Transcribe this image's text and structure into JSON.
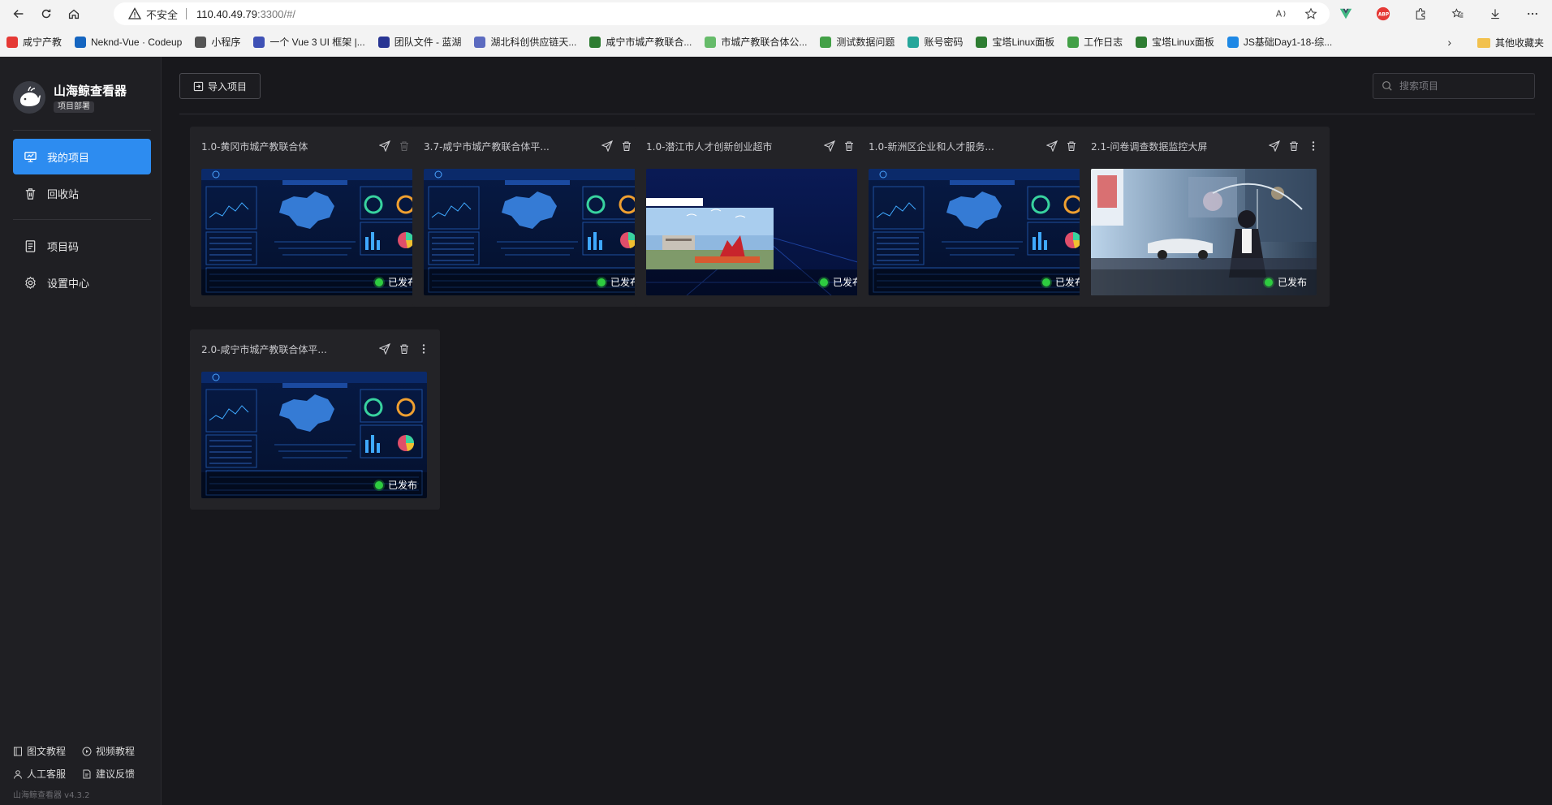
{
  "browser": {
    "security_label": "不安全",
    "url_host": "110.40.49.79",
    "url_path": ":3300/#/",
    "bookmarks": [
      {
        "label": "咸宁产教",
        "color": "#e53935"
      },
      {
        "label": "Neknd-Vue · Codeup",
        "color": "#1565c0"
      },
      {
        "label": "小程序",
        "color": "#555555"
      },
      {
        "label": "一个 Vue 3 UI 框架 |...",
        "color": "#3f51b5"
      },
      {
        "label": "团队文件 - 蓝湖",
        "color": "#283593"
      },
      {
        "label": "湖北科创供应链天...",
        "color": "#5c6bc0"
      },
      {
        "label": "咸宁市城产教联合...",
        "color": "#2e7d32"
      },
      {
        "label": "市城产教联合体公...",
        "color": "#66bb6a"
      },
      {
        "label": "测试数据问题",
        "color": "#43a047"
      },
      {
        "label": "账号密码",
        "color": "#26a69a"
      },
      {
        "label": "宝塔Linux面板",
        "color": "#2e7d32"
      },
      {
        "label": "工作日志",
        "color": "#43a047"
      },
      {
        "label": "宝塔Linux面板",
        "color": "#2e7d32"
      },
      {
        "label": "JS基础Day1-18-综...",
        "color": "#1e88e5"
      }
    ],
    "other_bookmarks": "其他收藏夹"
  },
  "sidebar": {
    "app_title": "山海鲸查看器",
    "badge": "项目部署",
    "menu": [
      {
        "label": "我的项目",
        "icon": "monitor-icon"
      },
      {
        "label": "回收站",
        "icon": "trash-icon"
      },
      {
        "label": "项目码",
        "icon": "document-icon"
      },
      {
        "label": "设置中心",
        "icon": "gear-icon"
      }
    ],
    "footer": {
      "doc_tutorial": "图文教程",
      "video_tutorial": "视频教程",
      "support": "人工客服",
      "feedback": "建议反馈",
      "version": "山海鲸查看器 v4.3.2"
    }
  },
  "toolbar": {
    "import_label": "导入项目",
    "search_placeholder": "搜索项目"
  },
  "projects": [
    {
      "title": "1.0-黄冈市城产教联合体",
      "status": "已发布",
      "thumb": "dashboard"
    },
    {
      "title": "3.7-咸宁市城产教联合体平...",
      "status": "已发布",
      "thumb": "dashboard"
    },
    {
      "title": "1.0-潜江市人才创新创业超市",
      "status": "已发布",
      "thumb": "photo"
    },
    {
      "title": "1.0-新洲区企业和人才服务...",
      "status": "已发布",
      "thumb": "dashboard"
    },
    {
      "title": "2.1-问卷调查数据监控大屏",
      "status": "已发布",
      "thumb": "anime"
    },
    {
      "title": "2.0-咸宁市城产教联合体平...",
      "status": "已发布",
      "thumb": "dashboard"
    }
  ],
  "colors": {
    "accent": "#2d8cf0",
    "published": "#2ecc40",
    "background": "#18181c"
  }
}
